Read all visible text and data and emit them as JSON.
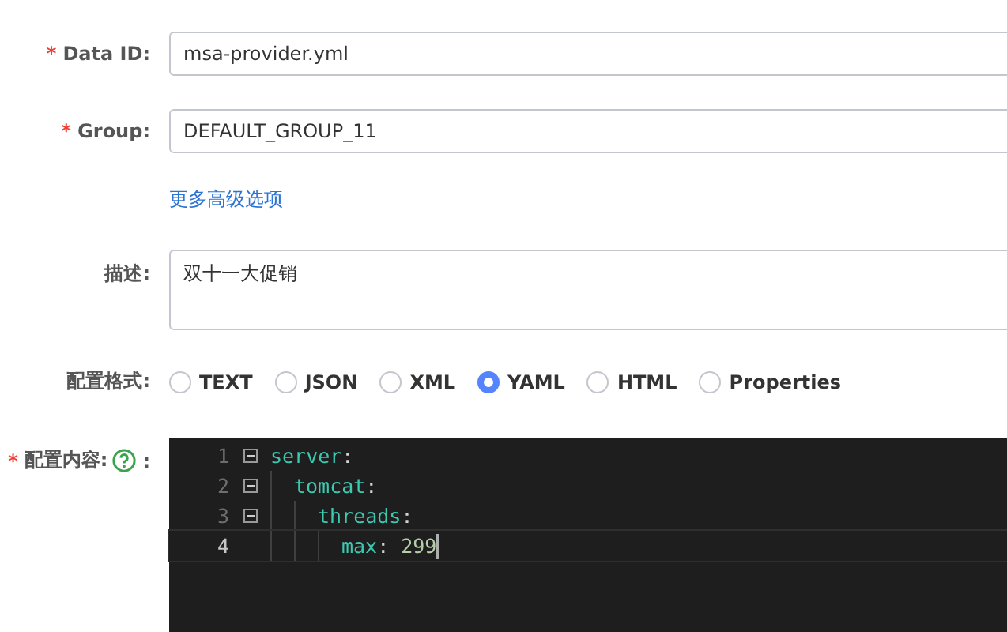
{
  "fields": [
    {
      "label": "Data ID:",
      "required_mark": "*",
      "value": "msa-provider.yml"
    },
    {
      "label": "Group:",
      "required_mark": "*",
      "value": "DEFAULT_GROUP_11"
    }
  ],
  "advanced_link": "更多高级选项",
  "description": {
    "label": "描述:",
    "value": "双十一大促销"
  },
  "format": {
    "label": "配置格式:",
    "options": [
      {
        "label": "TEXT",
        "selected": false
      },
      {
        "label": "JSON",
        "selected": false
      },
      {
        "label": "XML",
        "selected": false
      },
      {
        "label": "YAML",
        "selected": true
      },
      {
        "label": "HTML",
        "selected": false
      },
      {
        "label": "Properties",
        "selected": false
      }
    ]
  },
  "content": {
    "label": "配置内容:",
    "required_mark": "*",
    "suffix": ":",
    "lines": [
      {
        "number": "1",
        "key": "server",
        "colon": ":",
        "folded": false,
        "children": [
          {
            "number": "2",
            "key": "tomcat",
            "colon": ":",
            "folded": false,
            "children": [
              {
                "number": "3",
                "key": "threads",
                "colon": ":",
                "folded": false,
                "children": [
                  {
                    "number": "4",
                    "key": "max",
                    "colon": ":",
                    "value": "299",
                    "current": true
                  }
                ]
              }
            ]
          }
        ]
      }
    ]
  }
}
